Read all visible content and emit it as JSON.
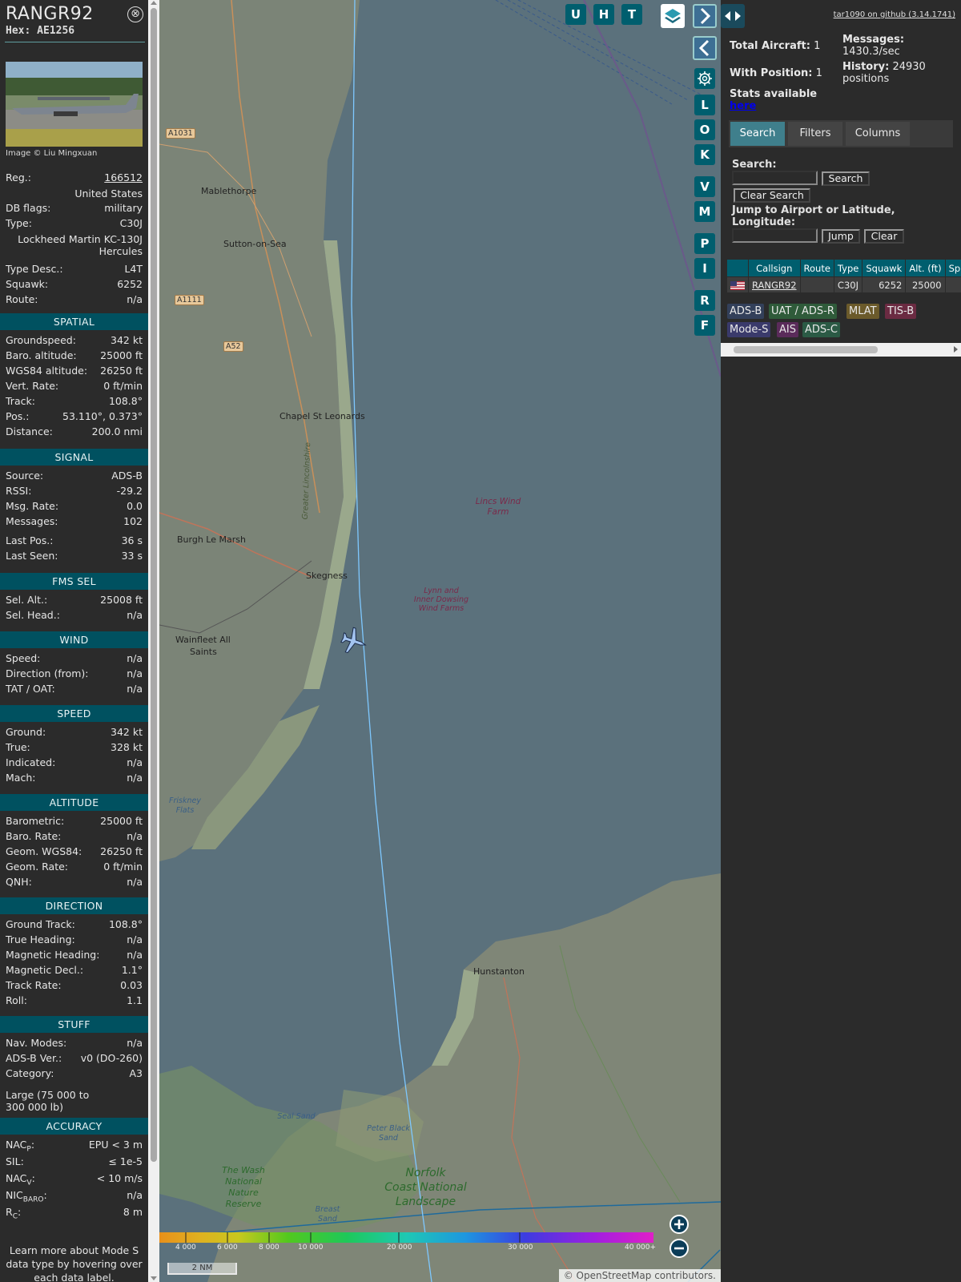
{
  "aircraft": {
    "callsign": "RANGR92",
    "hex": "Hex: AE1256",
    "photo_credit": "Image © Liu Mingxuan",
    "close_glyph": "⊗"
  },
  "details": {
    "reg_label": "Reg.:",
    "reg_value": "166512",
    "country": "United States",
    "db_flags_label": "DB flags:",
    "db_flags_value": "military",
    "type_label": "Type:",
    "type_value": "C30J",
    "type_full_1": "Lockheed Martin KC-130J",
    "type_full_2": "Hercules",
    "type_desc_label": "Type Desc.:",
    "type_desc_value": "L4T",
    "squawk_label": "Squawk:",
    "squawk_value": "6252",
    "route_label": "Route:",
    "route_value": "n/a"
  },
  "sections": {
    "spatial": "SPATIAL",
    "signal": "SIGNAL",
    "fms_sel": "FMS SEL",
    "wind": "WIND",
    "speed": "SPEED",
    "altitude": "ALTITUDE",
    "direction": "DIRECTION",
    "stuff": "STUFF",
    "accuracy": "ACCURACY"
  },
  "spatial": [
    {
      "k": "Groundspeed:",
      "v": "342 kt"
    },
    {
      "k": "Baro. altitude:",
      "v": "25000 ft"
    },
    {
      "k": "WGS84 altitude:",
      "v": "26250 ft"
    },
    {
      "k": "Vert. Rate:",
      "v": "0 ft/min"
    },
    {
      "k": "Track:",
      "v": "108.8°"
    },
    {
      "k": "Pos.:",
      "v": "53.110°, 0.373°"
    },
    {
      "k": "Distance:",
      "v": "200.0 nmi"
    }
  ],
  "signal": [
    {
      "k": "Source:",
      "v": "ADS-B"
    },
    {
      "k": "RSSI:",
      "v": "-29.2"
    },
    {
      "k": "Msg. Rate:",
      "v": "0.0"
    },
    {
      "k": "Messages:",
      "v": "102"
    },
    {
      "k": "Last Pos.:",
      "v": "36 s"
    },
    {
      "k": "Last Seen:",
      "v": "33 s"
    }
  ],
  "fms_sel": [
    {
      "k": "Sel. Alt.:",
      "v": "25008 ft"
    },
    {
      "k": "Sel. Head.:",
      "v": "n/a"
    }
  ],
  "wind": [
    {
      "k": "Speed:",
      "v": "n/a"
    },
    {
      "k": "Direction (from):",
      "v": "n/a"
    },
    {
      "k": "TAT / OAT:",
      "v": "n/a"
    }
  ],
  "speed": [
    {
      "k": "Ground:",
      "v": "342 kt"
    },
    {
      "k": "True:",
      "v": "328 kt"
    },
    {
      "k": "Indicated:",
      "v": "n/a"
    },
    {
      "k": "Mach:",
      "v": "n/a"
    }
  ],
  "altitude": [
    {
      "k": "Barometric:",
      "v": "25000 ft"
    },
    {
      "k": "Baro. Rate:",
      "v": "n/a"
    },
    {
      "k": "Geom. WGS84:",
      "v": "26250 ft"
    },
    {
      "k": "Geom. Rate:",
      "v": "0 ft/min"
    },
    {
      "k": "QNH:",
      "v": "n/a"
    }
  ],
  "direction": [
    {
      "k": "Ground Track:",
      "v": "108.8°"
    },
    {
      "k": "True Heading:",
      "v": "n/a"
    },
    {
      "k": "Magnetic Heading:",
      "v": "n/a"
    },
    {
      "k": "Magnetic Decl.:",
      "v": "1.1°"
    },
    {
      "k": "Track Rate:",
      "v": "0.03"
    },
    {
      "k": "Roll:",
      "v": "1.1"
    }
  ],
  "stuff": [
    {
      "k": "Nav. Modes:",
      "v": "n/a"
    },
    {
      "k": "ADS-B Ver.:",
      "v": "v0 (DO-260)"
    },
    {
      "k": "Category:",
      "v": "A3"
    }
  ],
  "stuff_category_desc_1": "Large (75 000 to",
  "stuff_category_desc_2": "300 000 lb)",
  "accuracy": [
    {
      "k": "NAC",
      "sub": "P",
      "tail": ":",
      "v": "EPU < 3 m"
    },
    {
      "k": "SIL:",
      "sub": "",
      "tail": "",
      "v": "≤ 1e-5"
    },
    {
      "k": "NAC",
      "sub": "V",
      "tail": ":",
      "v": "< 10 m/s"
    },
    {
      "k": "NIC",
      "sub": "BARO",
      "tail": ":",
      "v": "n/a"
    },
    {
      "k": "R",
      "sub": "C",
      "tail": ":",
      "v": "8 m"
    }
  ],
  "learn_more": [
    "Learn more about Mode S",
    "data type by hovering over",
    "each data label."
  ],
  "map": {
    "buttons_top": [
      "U",
      "H",
      "T"
    ],
    "buttons_side": [
      "L",
      "O",
      "K",
      "V",
      "M",
      "P",
      "I",
      "R",
      "F"
    ],
    "places": [
      {
        "name": "Mablethorpe"
      },
      {
        "name": "Sutton-on-Sea"
      },
      {
        "name": "Chapel St Leonards"
      },
      {
        "name": "Burgh Le Marsh"
      },
      {
        "name": "Skegness"
      },
      {
        "name": "Wainfleet All"
      },
      {
        "name": "Saints"
      },
      {
        "name": "Hunstanton"
      }
    ],
    "roads": [
      "A1031",
      "A1111",
      "A52"
    ],
    "sea_labels": [
      [
        "Lincs Wind",
        "Farm"
      ],
      [
        "Lynn and",
        "Inner Dowsing",
        "Wind Farms"
      ]
    ],
    "district_label": "Greater Lincolnshire",
    "tide_labels": [
      [
        "Friskney",
        "Flats"
      ],
      [
        "Seal Sand"
      ],
      [
        "Peter Black",
        "Sand"
      ],
      [
        "Breast",
        "Sand"
      ]
    ],
    "park_labels": [
      [
        "The Wash",
        "National",
        "Nature",
        "Reserve"
      ],
      [
        "Norfolk",
        "Coast National",
        "Landscape"
      ]
    ],
    "altitude_ticks": [
      "4 000",
      "6 000",
      "8 000",
      "10 000",
      "20 000",
      "30 000",
      "40 000+"
    ],
    "scale": "2 NM",
    "attribution_prefix": "© ",
    "attribution_link": "OpenStreetMap",
    "attribution_suffix": " contributors."
  },
  "sidebar": {
    "github": "tar1090 on github (3.14.1741)",
    "total_aircraft_label": "Total Aircraft:",
    "total_aircraft_value": "1",
    "with_position_label": "With Position:",
    "with_position_value": "1",
    "messages_label": "Messages:",
    "messages_value": "1430.3/sec",
    "history_label": "History:",
    "history_value": "24930",
    "history_unit": "positions",
    "stats_label": "Stats available",
    "stats_link": "here",
    "tabs": [
      "Search",
      "Filters",
      "Columns"
    ],
    "search_label": "Search:",
    "search_button": "Search",
    "clear_search_button": "Clear Search",
    "jump_label_1": "Jump to Airport or Latitude,",
    "jump_label_2": "Longitude:",
    "jump_button": "Jump",
    "clear_button": "Clear",
    "table_headers": [
      "",
      "Callsign",
      "Route",
      "Type",
      "Squawk",
      "Alt. (ft)",
      "Sp"
    ],
    "table_rows": [
      {
        "callsign": "RANGR92",
        "route": "",
        "type": "C30J",
        "squawk": "6252",
        "alt": "25000",
        "sp": ""
      }
    ],
    "legend": [
      {
        "label": "ADS-B",
        "color": "#33405a"
      },
      {
        "label": "UAT / ADS-R",
        "color": "#2f5b3a"
      },
      {
        "label": "MLAT",
        "color": "#6b5a2b"
      },
      {
        "label": "TIS-B",
        "color": "#6b2b42"
      },
      {
        "label": "Mode-S",
        "color": "#3a3a6b"
      },
      {
        "label": "AIS",
        "color": "#5a2b5a"
      },
      {
        "label": "ADS-C",
        "color": "#2b5a45"
      }
    ]
  }
}
